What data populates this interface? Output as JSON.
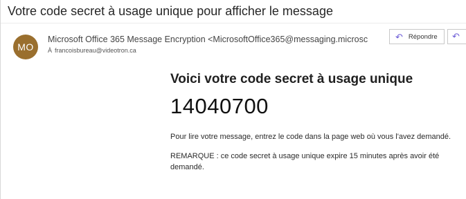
{
  "email": {
    "subject": "Votre code secret à usage unique pour afficher le message",
    "sender": {
      "initials": "MO",
      "avatar_color": "#9a6f2e",
      "display": "Microsoft Office 365 Message Encryption <MicrosoftOffice365@messaging.microsc",
      "to_label": "À",
      "to_address": "francoisbureau@videotron.ca"
    },
    "actions": {
      "reply_label": "Répondre"
    },
    "body": {
      "heading": "Voici votre code secret à usage unique",
      "code": "14040700",
      "paragraph1": "Pour lire votre message, entrez le code dans la page web où vous l'avez demandé.",
      "paragraph2": "REMARQUE : ce code secret à usage unique expire 15 minutes après avoir été demandé."
    }
  },
  "colors": {
    "accent": "#6b5bd6"
  }
}
